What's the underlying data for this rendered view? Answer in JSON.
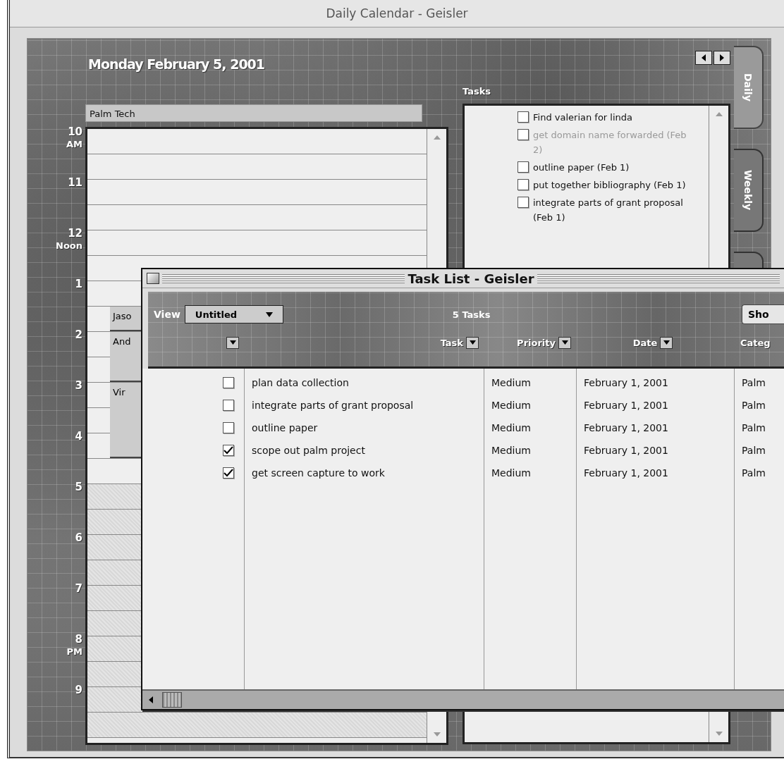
{
  "calendar_window": {
    "title": "Daily Calendar - Geisler",
    "date": "Monday February 5, 2001",
    "calendar_name": "Palm Tech",
    "hours": [
      {
        "hour": "10",
        "period": "AM",
        "off_hours": false
      },
      {
        "hour": "11",
        "off_hours": false
      },
      {
        "hour": "12",
        "period": "Noon",
        "off_hours": false
      },
      {
        "hour": "1",
        "off_hours": false
      },
      {
        "hour": "2",
        "off_hours": false
      },
      {
        "hour": "3",
        "off_hours": false
      },
      {
        "hour": "4",
        "off_hours": false
      },
      {
        "hour": "5",
        "off_hours": true
      },
      {
        "hour": "6",
        "off_hours": true
      },
      {
        "hour": "7",
        "off_hours": true
      },
      {
        "hour": "8",
        "period": "PM",
        "off_hours": true
      },
      {
        "hour": "9",
        "off_hours": true
      }
    ],
    "appointments": [
      {
        "title": "Jaso"
      },
      {
        "title": "And"
      },
      {
        "title": "Vir"
      }
    ],
    "tasks_label": "Tasks",
    "tasks": [
      {
        "text": "Find valerian for linda",
        "checked": false,
        "dimmed": false
      },
      {
        "text": "get domain name forwarded (Feb 2)",
        "checked": false,
        "dimmed": true
      },
      {
        "text": "outline paper (Feb 1)",
        "checked": false,
        "dimmed": false
      },
      {
        "text": "put together bibliography (Feb 1)",
        "checked": false,
        "dimmed": false
      },
      {
        "text": "integrate parts of grant proposal (Feb 1)",
        "checked": false,
        "dimmed": false
      }
    ],
    "tabs": [
      {
        "label": "Daily",
        "selected": true
      },
      {
        "label": "Weekly",
        "selected": false
      },
      {
        "selected": false
      }
    ]
  },
  "task_list_window": {
    "title": "Task List - Geisler",
    "view_label": "View",
    "view": "Untitled",
    "count": "5 Tasks",
    "show_button": "Sho",
    "columns": [
      {
        "kind": "check"
      },
      {
        "kind": "text",
        "label": "Task"
      },
      {
        "kind": "text",
        "label": "Priority"
      },
      {
        "kind": "text",
        "label": "Date"
      },
      {
        "kind": "text",
        "label": "Categ"
      }
    ],
    "rows": [
      {
        "done": false,
        "task": "plan data collection",
        "priority": "Medium",
        "date": "February 1, 2001",
        "category": "Palm"
      },
      {
        "done": false,
        "task": "integrate parts of grant proposal",
        "priority": "Medium",
        "date": "February 1, 2001",
        "category": "Palm"
      },
      {
        "done": false,
        "task": "outline paper",
        "priority": "Medium",
        "date": "February 1, 2001",
        "category": "Palm"
      },
      {
        "done": true,
        "task": "scope out palm project",
        "priority": "Medium",
        "date": "February 1, 2001",
        "category": "Palm"
      },
      {
        "done": true,
        "task": "get screen capture to work",
        "priority": "Medium",
        "date": "February 1, 2001",
        "category": "Palm"
      }
    ]
  }
}
